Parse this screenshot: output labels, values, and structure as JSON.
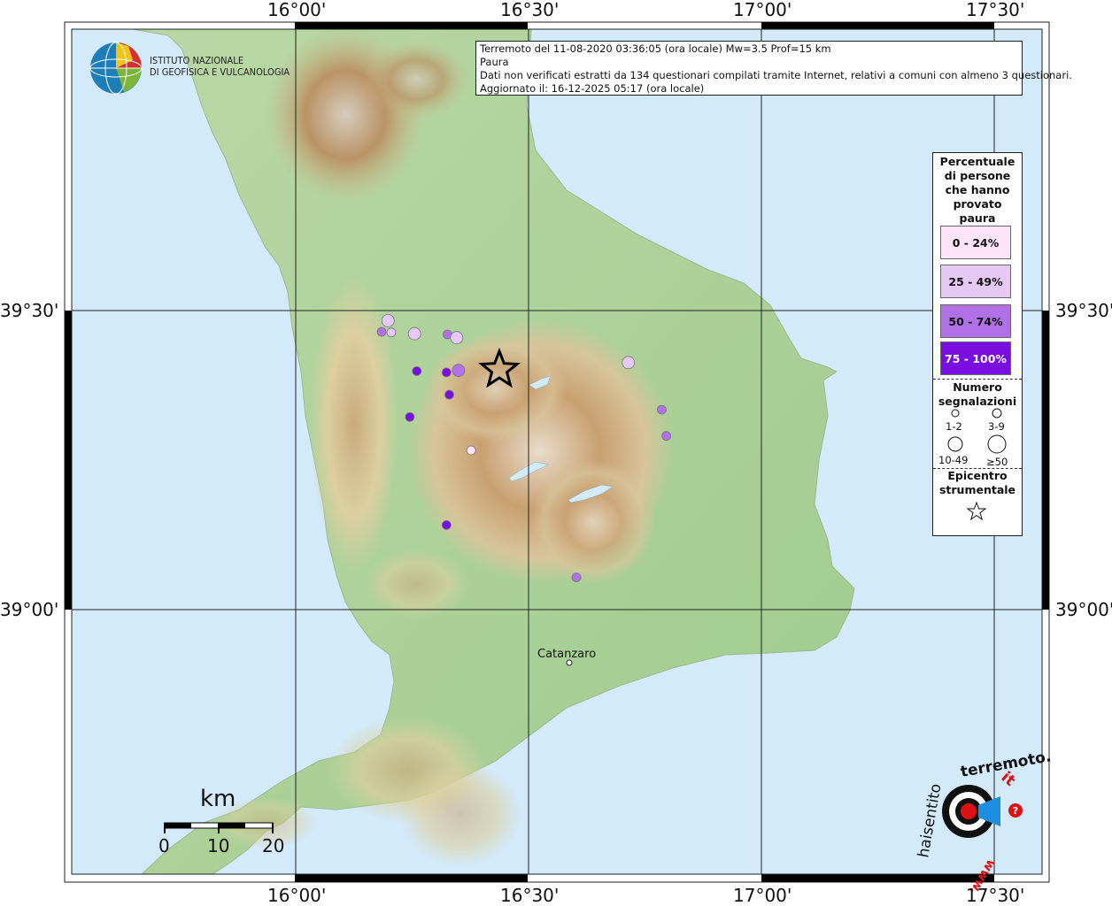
{
  "header": {
    "line1": "Terremoto del 11-08-2020 03:36:05 (ora locale) Mw=3.5 Prof=15 km",
    "line2": "Paura",
    "line3": "Dati non verificati estratti da 134 questionari compilati tramite Internet, relativi a comuni con almeno 3 questionari.",
    "line4": "Aggiornato il: 16-12-2025 05:17 (ora locale)"
  },
  "logo": {
    "line1": "ISTITUTO NAZIONALE",
    "line2": "DI GEOFISICA E VULCANOLOGIA"
  },
  "axes": {
    "lon_top": [
      "16°00'",
      "16°30'",
      "17°00'",
      "17°30'"
    ],
    "lon_bottom": [
      "16°00'",
      "16°30'",
      "17°00'",
      "17°30'"
    ],
    "lat_left": [
      "39°30'",
      "39°00'"
    ],
    "lat_right": [
      "39°30'",
      "39°00'"
    ]
  },
  "legend": {
    "title": "Percentuale\ndi persone\nche hanno\nprovato\npaura",
    "classes": [
      {
        "label": "0 - 24%",
        "color": "#fde4f8",
        "text_color": "#111"
      },
      {
        "label": "25 - 49%",
        "color": "#e6c8f5",
        "text_color": "#111"
      },
      {
        "label": "50 - 74%",
        "color": "#b071e6",
        "text_color": "#111"
      },
      {
        "label": "75 - 100%",
        "color": "#7a0ee0",
        "text_color": "#fff"
      }
    ],
    "count_title": "Numero\nsegnalazioni",
    "counts": [
      "1-2",
      "3-9",
      "10-49",
      "≥50"
    ],
    "epicenter_title": "Epicentro\nstrumentale"
  },
  "places": {
    "catanzaro": "Catanzaro"
  },
  "scale": {
    "unit": "km",
    "ticks": [
      "0",
      "10",
      "20"
    ]
  },
  "observations": [
    {
      "lon": 16.19,
      "lat": 39.345,
      "cls": 1,
      "n": "3-9"
    },
    {
      "lon": 16.176,
      "lat": 39.328,
      "cls": 2,
      "n": "1-2"
    },
    {
      "lon": 16.197,
      "lat": 39.327,
      "cls": 1,
      "n": "1-2"
    },
    {
      "lon": 16.247,
      "lat": 39.325,
      "cls": 1,
      "n": "3-9"
    },
    {
      "lon": 16.318,
      "lat": 39.324,
      "cls": 2,
      "n": "1-2"
    },
    {
      "lon": 16.338,
      "lat": 39.319,
      "cls": 1,
      "n": "3-9"
    },
    {
      "lon": 16.252,
      "lat": 39.268,
      "cls": 3,
      "n": "1-2"
    },
    {
      "lon": 16.316,
      "lat": 39.266,
      "cls": 3,
      "n": "1-2"
    },
    {
      "lon": 16.342,
      "lat": 39.269,
      "cls": 2,
      "n": "3-9"
    },
    {
      "lon": 16.322,
      "lat": 39.232,
      "cls": 3,
      "n": "1-2"
    },
    {
      "lon": 16.237,
      "lat": 39.198,
      "cls": 3,
      "n": "1-2"
    },
    {
      "lon": 16.369,
      "lat": 39.147,
      "cls": 0,
      "n": "1-2"
    },
    {
      "lon": 16.708,
      "lat": 39.281,
      "cls": 1,
      "n": "3-9"
    },
    {
      "lon": 16.78,
      "lat": 39.209,
      "cls": 2,
      "n": "1-2"
    },
    {
      "lon": 16.79,
      "lat": 39.169,
      "cls": 2,
      "n": "1-2"
    },
    {
      "lon": 16.316,
      "lat": 39.033,
      "cls": 3,
      "n": "1-2"
    },
    {
      "lon": 16.596,
      "lat": 38.953,
      "cls": 2,
      "n": "1-2"
    }
  ],
  "epicenter": {
    "lon": 16.43,
    "lat": 39.27
  },
  "map_extent": {
    "lon_min": 15.508,
    "lon_max": 17.6,
    "lat_min": 38.5,
    "lat_max": 39.79
  },
  "colors": {
    "sea": "#d3eafa",
    "land_low": "#a9d39a",
    "grid": "#222"
  }
}
